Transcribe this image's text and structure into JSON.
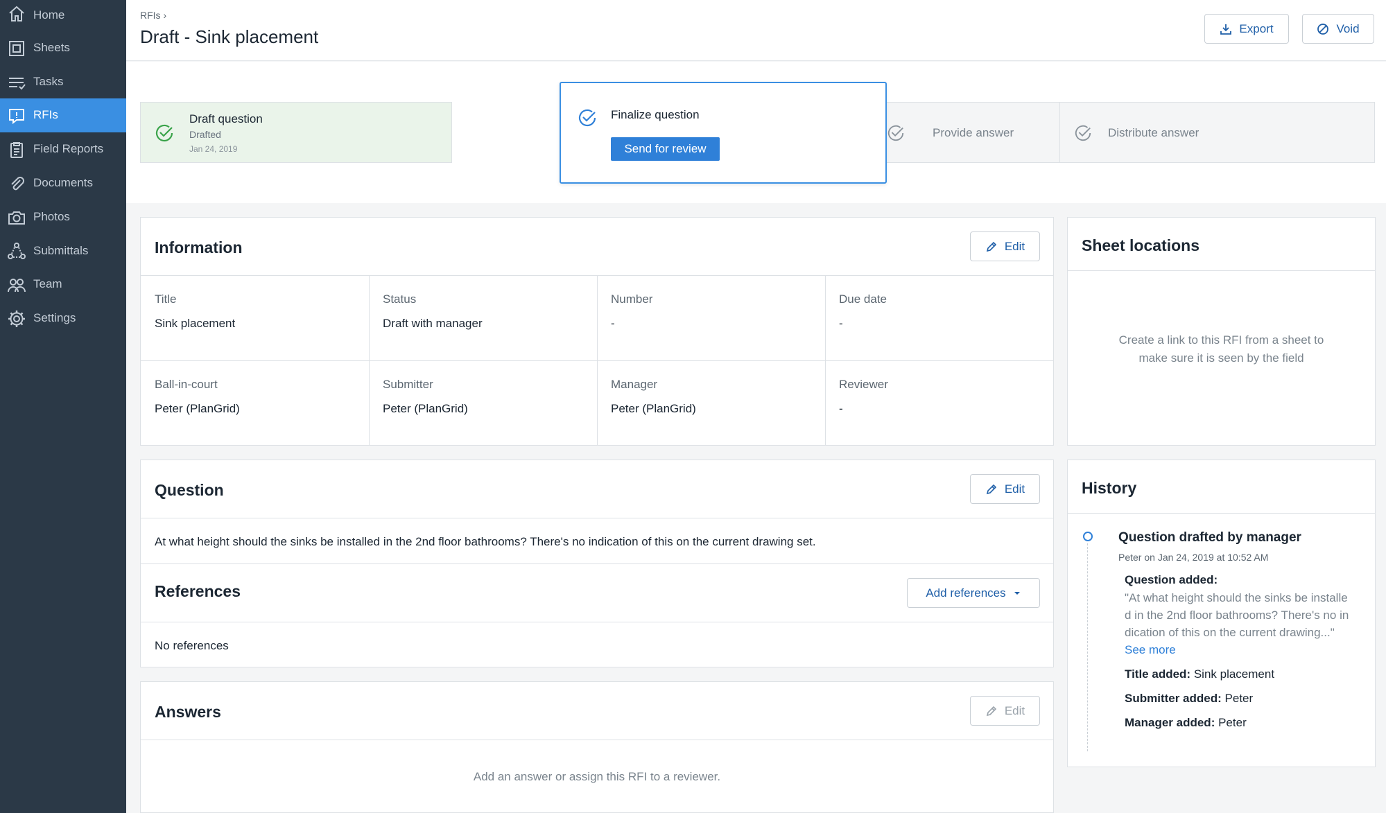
{
  "sidebar": {
    "items": [
      {
        "label": "Home",
        "icon": "home-icon"
      },
      {
        "label": "Sheets",
        "icon": "sheets-icon"
      },
      {
        "label": "Tasks",
        "icon": "tasks-icon"
      },
      {
        "label": "RFIs",
        "icon": "rfi-icon",
        "active": true
      },
      {
        "label": "Field Reports",
        "icon": "clipboard-icon"
      },
      {
        "label": "Documents",
        "icon": "paperclip-icon"
      },
      {
        "label": "Photos",
        "icon": "camera-icon"
      },
      {
        "label": "Submittals",
        "icon": "submittals-icon"
      },
      {
        "label": "Team",
        "icon": "team-icon"
      },
      {
        "label": "Settings",
        "icon": "gear-icon"
      }
    ]
  },
  "header": {
    "breadcrumb": "RFIs ›",
    "title": "Draft - Sink placement",
    "export_label": "Export",
    "void_label": "Void"
  },
  "steps": {
    "draft": {
      "title": "Draft question",
      "status": "Drafted",
      "date": "Jan 24, 2019"
    },
    "finalize": {
      "title": "Finalize question",
      "button": "Send for review"
    },
    "answer": {
      "title": "Provide answer"
    },
    "distribute": {
      "title": "Distribute answer"
    }
  },
  "information": {
    "title": "Information",
    "edit_label": "Edit",
    "fields": [
      {
        "label": "Title",
        "value": "Sink placement"
      },
      {
        "label": "Status",
        "value": "Draft with manager"
      },
      {
        "label": "Number",
        "value": "-"
      },
      {
        "label": "Due date",
        "value": "-"
      },
      {
        "label": "Ball-in-court",
        "value": "Peter (PlanGrid)"
      },
      {
        "label": "Submitter",
        "value": "Peter (PlanGrid)"
      },
      {
        "label": "Manager",
        "value": "Peter (PlanGrid)"
      },
      {
        "label": "Reviewer",
        "value": "-"
      }
    ]
  },
  "question": {
    "title": "Question",
    "edit_label": "Edit",
    "text": "At what height should the sinks be installed in the 2nd floor bathrooms? There's no indication of this on the current drawing set."
  },
  "references": {
    "title": "References",
    "add_label": "Add references",
    "empty": "No references"
  },
  "answers": {
    "title": "Answers",
    "edit_label": "Edit",
    "empty": "Add an answer or assign this RFI to a reviewer."
  },
  "sheet_locations": {
    "title": "Sheet locations",
    "empty_line1": "Create a link to this RFI from a sheet to",
    "empty_line2": "make sure it is seen by the field"
  },
  "history": {
    "title": "History",
    "event_title": "Question drafted by manager",
    "event_meta": "Peter on Jan 24, 2019 at 10:52 AM",
    "question_added_label": "Question added:",
    "quote_line1": "\"At what height should the sinks be installe",
    "quote_line2": "d in the 2nd floor bathrooms? There's no in",
    "quote_line3": "dication of this on the current drawing...\"",
    "see_more": "See more",
    "title_added_label": "Title added:",
    "title_added_value": "Sink placement",
    "submitter_added_label": "Submitter added:",
    "submitter_added_value": "Peter",
    "manager_added_label": "Manager added:",
    "manager_added_value": "Peter"
  },
  "colors": {
    "sidebar_bg": "#2b3947",
    "active_nav": "#3a8fe2",
    "primary": "#2f80d8",
    "done_step_bg": "#eaf4ea",
    "done_check": "#3aa34a"
  }
}
